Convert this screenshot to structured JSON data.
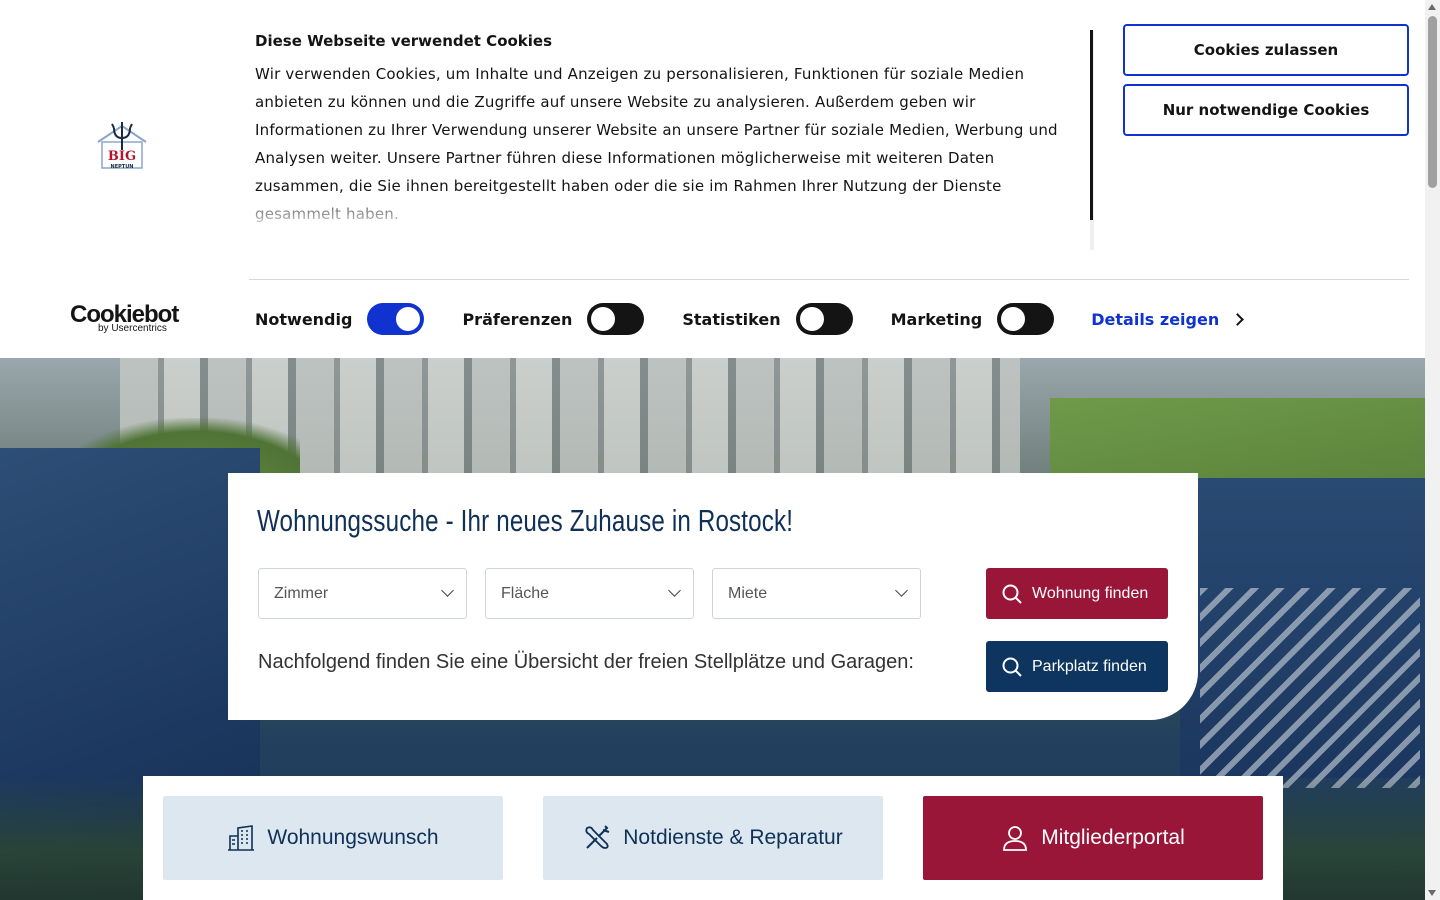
{
  "cookie_banner": {
    "title": "Diese Webseite verwendet Cookies",
    "text": "Wir verwenden Cookies, um Inhalte und Anzeigen zu personalisieren, Funktionen für soziale Medien anbieten zu können und die Zugriffe auf unsere Website zu analysieren. Außerdem geben wir Informationen zu Ihrer Verwendung unserer Website an unsere Partner für soziale Medien, Werbung und Analysen weiter. Unsere Partner führen diese Informationen möglicherweise mit weiteren Daten zusammen, die Sie ihnen bereitgestellt haben oder die sie im Rahmen Ihrer Nutzung der Dienste gesammelt haben.",
    "allow_button": "Cookies zulassen",
    "necessary_button": "Nur notwendige Cookies",
    "logo_text": {
      "top": "BIG",
      "bottom": "NEPTUN"
    },
    "brand": {
      "name": "Cookiebot",
      "sub": "by Usercentrics"
    },
    "toggles": [
      {
        "label": "Notwendig",
        "state": "on"
      },
      {
        "label": "Präferenzen",
        "state": "off"
      },
      {
        "label": "Statistiken",
        "state": "off"
      },
      {
        "label": "Marketing",
        "state": "off"
      }
    ],
    "details_link": "Details zeigen",
    "colors": {
      "accent": "#1032cf",
      "text": "#141414"
    }
  },
  "search": {
    "title": "Wohnungssuche - Ihr neues Zuhause in Rostock!",
    "selects": [
      {
        "placeholder": "Zimmer",
        "icon": "chevron-down-icon"
      },
      {
        "placeholder": "Fläche",
        "icon": "chevron-down-icon"
      },
      {
        "placeholder": "Miete",
        "icon": "chevron-down-icon"
      }
    ],
    "find_apartment_button": "Wohnung finden",
    "parking_text": "Nachfolgend finden Sie eine Übersicht der freien Stellplätze und Garagen:",
    "find_parking_button": "Parkplatz finden",
    "colors": {
      "primary": "#9a1638",
      "secondary": "#0e3560",
      "title": "#0f3057"
    }
  },
  "quick_links": [
    {
      "label": "Wohnungswunsch",
      "icon": "building-icon"
    },
    {
      "label": "Notdienste & Reparatur",
      "icon": "tools-icon"
    },
    {
      "label": "Mitgliederportal",
      "icon": "user-icon"
    }
  ]
}
